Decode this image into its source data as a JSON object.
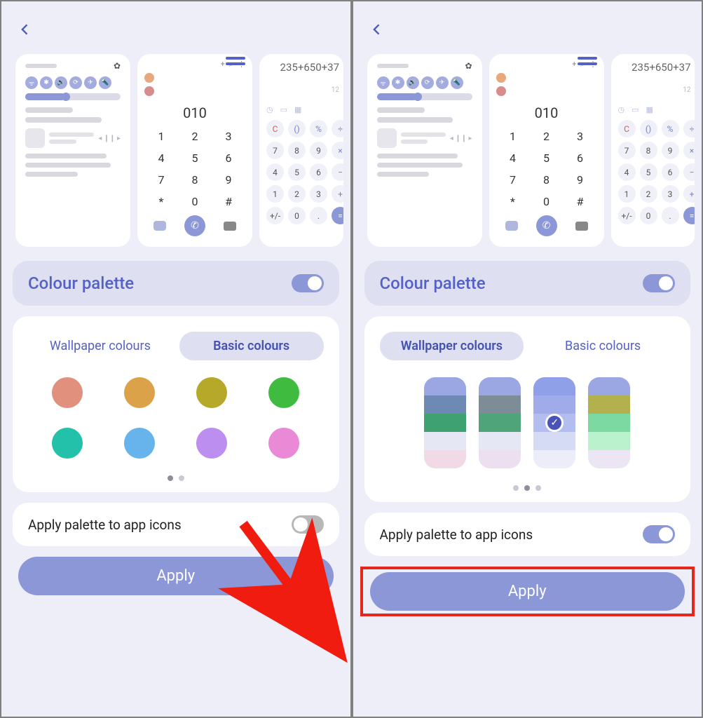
{
  "left": {
    "colour_palette_label": "Colour palette",
    "cp_toggle": true,
    "tabs": {
      "wallpaper": "Wallpaper colours",
      "basic": "Basic colours",
      "active": "basic"
    },
    "basic_colors": [
      "#e2907e",
      "#dba249",
      "#b6a828",
      "#3fbc3f",
      "#23c1a9",
      "#67b3eb",
      "#bb8ef0",
      "#ea8ad6"
    ],
    "dots": 2,
    "active_dot": 0,
    "apply_palette_label": "Apply palette to app icons",
    "apply_palette_toggle": false,
    "apply_button": "Apply"
  },
  "right": {
    "colour_palette_label": "Colour palette",
    "cp_toggle": true,
    "tabs": {
      "wallpaper": "Wallpaper colours",
      "basic": "Basic colours",
      "active": "wallpaper"
    },
    "wallpaper_palettes": [
      {
        "c": [
          "#9ba7e2",
          "#6f89b5",
          "#3da171",
          "#e5e8f4",
          "#f2d9e6"
        ],
        "selected": false
      },
      {
        "c": [
          "#9ba7e2",
          "#7d8c96",
          "#4fa479",
          "#e5e8f4",
          "#ece0f0"
        ],
        "selected": false
      },
      {
        "c": [
          "#90a0e8",
          "#a0acea",
          "#b3bdf0",
          "#d6dbf5",
          "#ecedf9"
        ],
        "selected": true
      },
      {
        "c": [
          "#9ba7e2",
          "#b3b04e",
          "#7dd9a2",
          "#b9f2cc",
          "#ece5f3"
        ],
        "selected": false
      }
    ],
    "dots": 3,
    "active_dot": 1,
    "apply_palette_label": "Apply palette to app icons",
    "apply_palette_toggle": true,
    "apply_button": "Apply",
    "highlight_apply": true
  },
  "preview_dialer": {
    "display": "010",
    "keys": [
      "1",
      "2",
      "3",
      "4",
      "5",
      "6",
      "7",
      "8",
      "9",
      "*",
      "0",
      "#"
    ]
  },
  "preview_calc": {
    "expr": "235+650+37",
    "sub": "12",
    "keys": [
      {
        "t": "C",
        "cls": "red"
      },
      {
        "t": "()"
      },
      {
        "t": "%"
      },
      {
        "t": "÷"
      },
      {
        "t": "7",
        "cls": "num"
      },
      {
        "t": "8",
        "cls": "num"
      },
      {
        "t": "9",
        "cls": "num"
      },
      {
        "t": "×"
      },
      {
        "t": "4",
        "cls": "num"
      },
      {
        "t": "5",
        "cls": "num"
      },
      {
        "t": "6",
        "cls": "num"
      },
      {
        "t": "−"
      },
      {
        "t": "1",
        "cls": "num"
      },
      {
        "t": "2",
        "cls": "num"
      },
      {
        "t": "3",
        "cls": "num"
      },
      {
        "t": "+"
      },
      {
        "t": "+/-",
        "cls": "num"
      },
      {
        "t": "0",
        "cls": "num"
      },
      {
        "t": ".",
        "cls": "num"
      },
      {
        "t": "=",
        "cls": "eq"
      }
    ]
  }
}
